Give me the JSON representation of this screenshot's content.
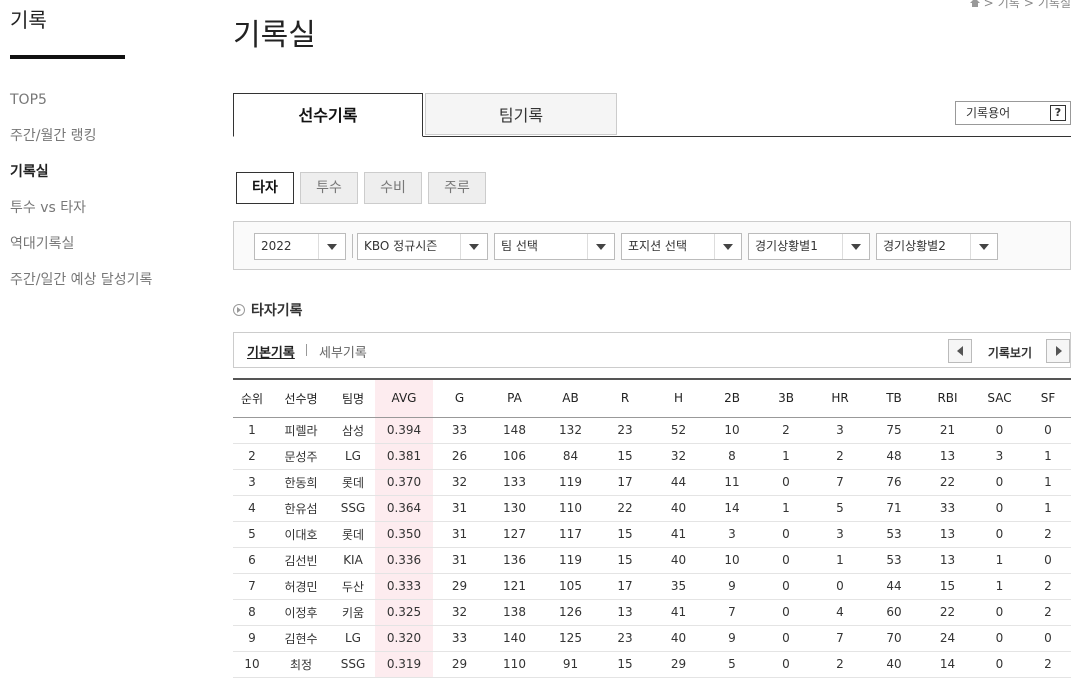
{
  "sidebar": {
    "title": "기록",
    "items": [
      {
        "label": "TOP5",
        "active": false
      },
      {
        "label": "주간/월간 랭킹",
        "active": false
      },
      {
        "label": "기록실",
        "active": true
      },
      {
        "label": "투수 vs 타자",
        "active": false
      },
      {
        "label": "역대기록실",
        "active": false
      },
      {
        "label": "주간/일간 예상 달성기록",
        "active": false
      }
    ]
  },
  "breadcrumb": {
    "items": [
      "기록",
      "기록실"
    ],
    "separator": ">"
  },
  "page_title": "기록실",
  "main_tabs": [
    {
      "label": "선수기록",
      "active": true
    },
    {
      "label": "팀기록",
      "active": false
    }
  ],
  "glossary_label": "기록용어",
  "glossary_icon": "?",
  "sub_tabs": [
    {
      "label": "타자",
      "active": true
    },
    {
      "label": "투수",
      "active": false
    },
    {
      "label": "수비",
      "active": false
    },
    {
      "label": "주루",
      "active": false
    }
  ],
  "filters": {
    "season": "2022",
    "series": "KBO 정규시즌",
    "team": "팀 선택",
    "position": "포지션 선택",
    "situation1": "경기상황별1",
    "situation2": "경기상황별2"
  },
  "section_title": "타자기록",
  "record_bar": {
    "basic": "기본기록",
    "detail": "세부기록",
    "view": "기록보기"
  },
  "table": {
    "headers": [
      "순위",
      "선수명",
      "팀명",
      "AVG",
      "G",
      "PA",
      "AB",
      "R",
      "H",
      "2B",
      "3B",
      "HR",
      "TB",
      "RBI",
      "SAC",
      "SF"
    ],
    "rows": [
      [
        "1",
        "피렐라",
        "삼성",
        "0.394",
        "33",
        "148",
        "132",
        "23",
        "52",
        "10",
        "2",
        "3",
        "75",
        "21",
        "0",
        "0"
      ],
      [
        "2",
        "문성주",
        "LG",
        "0.381",
        "26",
        "106",
        "84",
        "15",
        "32",
        "8",
        "1",
        "2",
        "48",
        "13",
        "3",
        "1"
      ],
      [
        "3",
        "한동희",
        "롯데",
        "0.370",
        "32",
        "133",
        "119",
        "17",
        "44",
        "11",
        "0",
        "7",
        "76",
        "22",
        "0",
        "1"
      ],
      [
        "4",
        "한유섬",
        "SSG",
        "0.364",
        "31",
        "130",
        "110",
        "22",
        "40",
        "14",
        "1",
        "5",
        "71",
        "33",
        "0",
        "1"
      ],
      [
        "5",
        "이대호",
        "롯데",
        "0.350",
        "31",
        "127",
        "117",
        "15",
        "41",
        "3",
        "0",
        "3",
        "53",
        "13",
        "0",
        "2"
      ],
      [
        "6",
        "김선빈",
        "KIA",
        "0.336",
        "31",
        "136",
        "119",
        "15",
        "40",
        "10",
        "0",
        "1",
        "53",
        "13",
        "1",
        "0"
      ],
      [
        "7",
        "허경민",
        "두산",
        "0.333",
        "29",
        "121",
        "105",
        "17",
        "35",
        "9",
        "0",
        "0",
        "44",
        "15",
        "1",
        "2"
      ],
      [
        "8",
        "이정후",
        "키움",
        "0.325",
        "32",
        "138",
        "126",
        "13",
        "41",
        "7",
        "0",
        "4",
        "60",
        "22",
        "0",
        "2"
      ],
      [
        "9",
        "김현수",
        "LG",
        "0.320",
        "33",
        "140",
        "125",
        "23",
        "40",
        "9",
        "0",
        "7",
        "70",
        "24",
        "0",
        "0"
      ],
      [
        "10",
        "최정",
        "SSG",
        "0.319",
        "29",
        "110",
        "91",
        "15",
        "29",
        "5",
        "0",
        "2",
        "40",
        "14",
        "0",
        "2"
      ]
    ]
  },
  "colors": {
    "avg_highlight": "#fdecef",
    "accent": "#111111"
  }
}
